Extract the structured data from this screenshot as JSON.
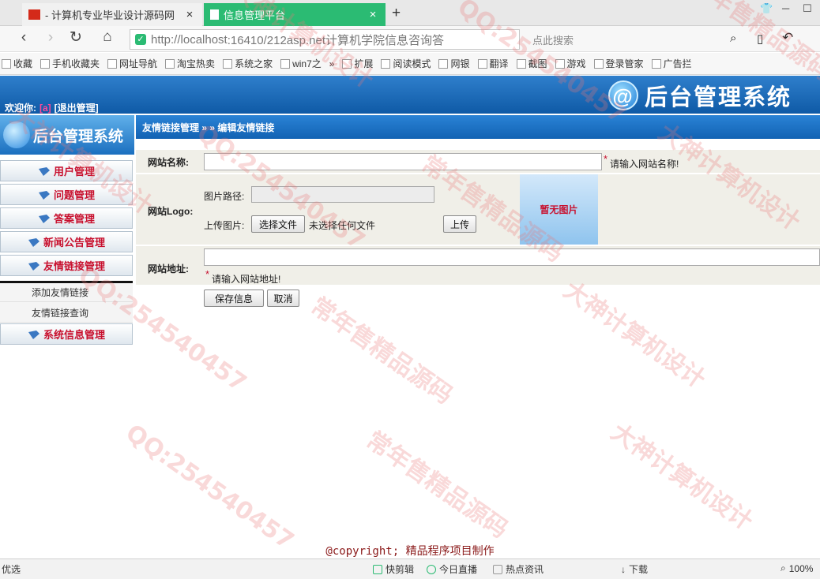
{
  "browser": {
    "tabs": [
      {
        "title": "- 计算机专业毕业设计源码网",
        "close": "×"
      },
      {
        "title": "信息管理平台",
        "close": "×"
      }
    ],
    "new_tab": "+",
    "address": {
      "host": "http://localhost",
      "rest": ":16410/212asp.net计算机学院信息咨询答",
      "search_placeholder": "点此搜索"
    },
    "bookmarks": [
      "收藏",
      "手机收藏夹",
      "网址导航",
      "淘宝热卖",
      "系统之家",
      "win7之",
      "»",
      "扩展",
      "阅读模式",
      "网银",
      "翻译",
      "截图",
      "游戏",
      "登录管家",
      "广告拦"
    ],
    "status": {
      "left": "优选",
      "items": [
        "快剪辑",
        "今日直播",
        "热点资讯",
        "下载"
      ],
      "zoom": "100%"
    }
  },
  "header": {
    "welcome": "欢迎你:",
    "user": "[a]",
    "logout": "[退出管理]",
    "brand": "后台管理系统"
  },
  "sidebar": {
    "title": "后台管理系统",
    "menus": [
      "用户管理",
      "问题管理",
      "答案管理",
      "新闻公告管理",
      "友情链接管理"
    ],
    "submenu": [
      "添加友情链接",
      "友情链接查询"
    ],
    "last_menu": "系统信息管理"
  },
  "crumb": "友情链接管理 » » 编辑友情链接",
  "form": {
    "name_label": "网站名称:",
    "name_value": "",
    "name_hint": "请输入网站名称!",
    "logo_label": "网站Logo:",
    "path_label": "图片路径:",
    "path_value": "",
    "upload_label": "上传图片:",
    "choose_file": "选择文件",
    "no_file": "未选择任何文件",
    "upload_btn": "上传",
    "no_image": "暂无图片",
    "url_label": "网站地址:",
    "url_value": "",
    "url_hint": "请输入网站地址!",
    "save_btn": "保存信息",
    "cancel_btn": "取消",
    "required_mark": "*"
  },
  "copyright": "@copyright; 精品程序项目制作",
  "watermark": {
    "texts": [
      "大神计算机设计",
      "QQ:254540457",
      "常年售精品源码"
    ]
  }
}
